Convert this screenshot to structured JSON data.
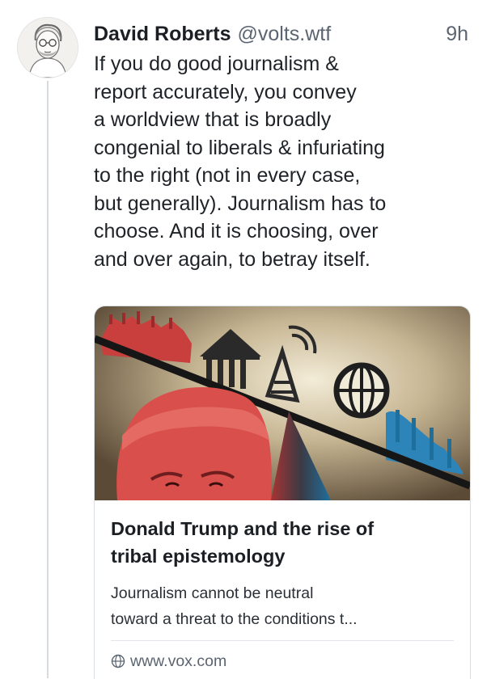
{
  "post": {
    "author": {
      "name": "David Roberts",
      "handle": "@volts.wtf",
      "avatar_icon": "avatar-sketch-portrait"
    },
    "timestamp": "9h",
    "text_lines": [
      "If you do good journalism &",
      "report accurately, you convey",
      "a worldview that is broadly",
      "congenial to liberals & infuriating",
      "to the right (not in every case,",
      "but generally). Journalism has to",
      "choose. And it is choosing, over",
      "and over again, to betray itself."
    ]
  },
  "link_card": {
    "title_lines": [
      "Donald Trump and the rise of",
      "tribal epistemology"
    ],
    "description_lines": [
      "Journalism cannot be neutral",
      "toward a threat to the conditions t..."
    ],
    "domain": "www.vox.com",
    "domain_icon": "globe-icon"
  },
  "colors": {
    "accent_red": "#c23a3a",
    "accent_blue": "#2a7fb0",
    "text": "#1f2328",
    "muted": "#5b6571",
    "thread_line": "#d6dbe0"
  }
}
